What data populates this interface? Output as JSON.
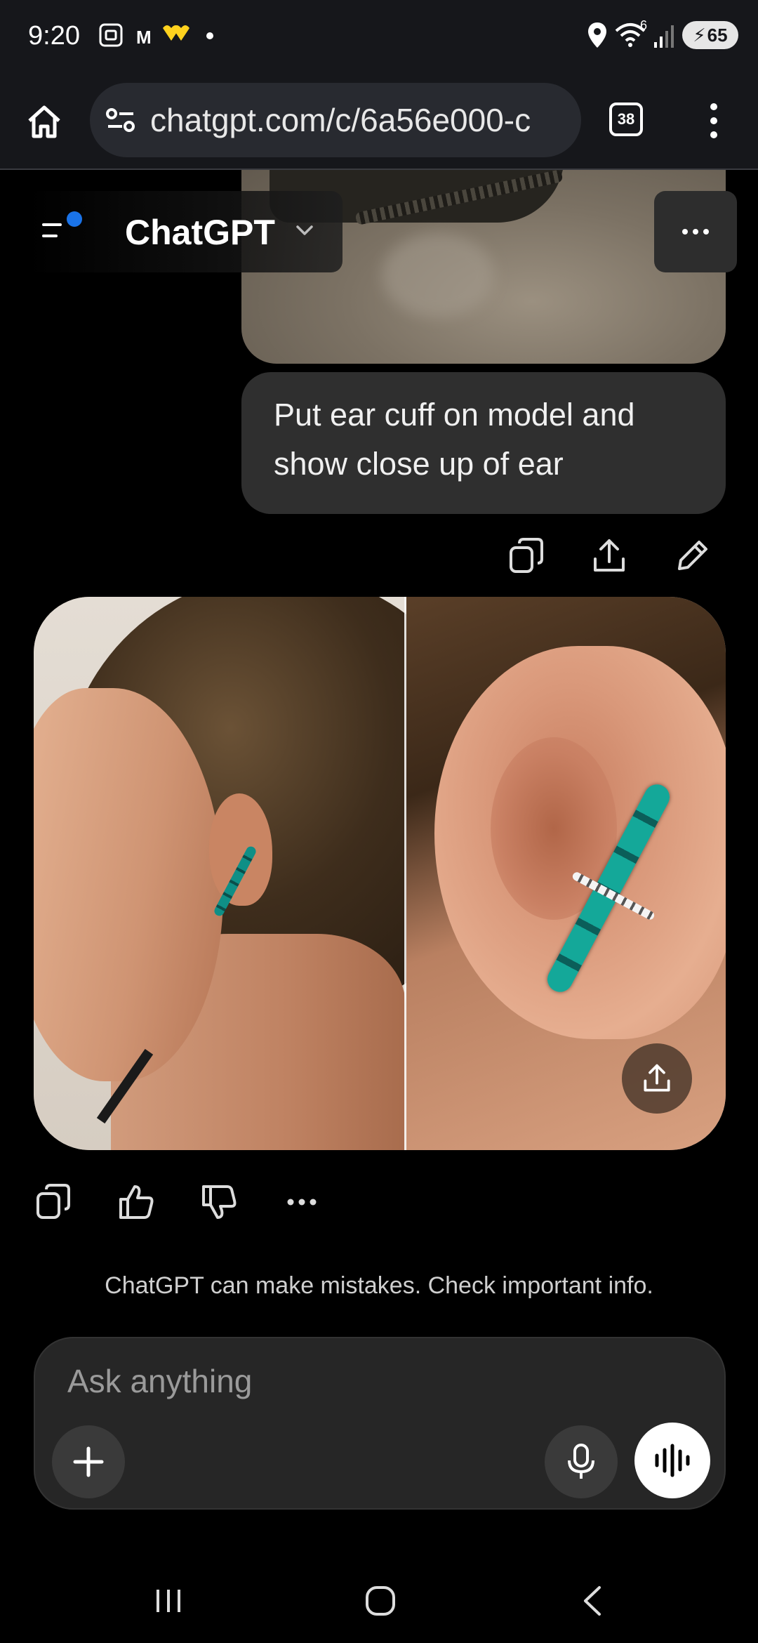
{
  "status_bar": {
    "time": "9:20",
    "notification_letter": "M",
    "battery_level": "65",
    "wifi_label": "6"
  },
  "browser": {
    "url": "chatgpt.com/c/6a56e000-c",
    "tab_count": "38"
  },
  "chat_header": {
    "title": "ChatGPT"
  },
  "conversation": {
    "user_message": "Put ear cuff on model and show close up of ear"
  },
  "disclaimer": "ChatGPT can make mistakes. Check important info.",
  "composer": {
    "placeholder": "Ask anything"
  },
  "colors": {
    "background": "#000000",
    "bubble": "#2f2f2f",
    "accent_dot": "#1a73e8",
    "gem": "#14a899"
  }
}
